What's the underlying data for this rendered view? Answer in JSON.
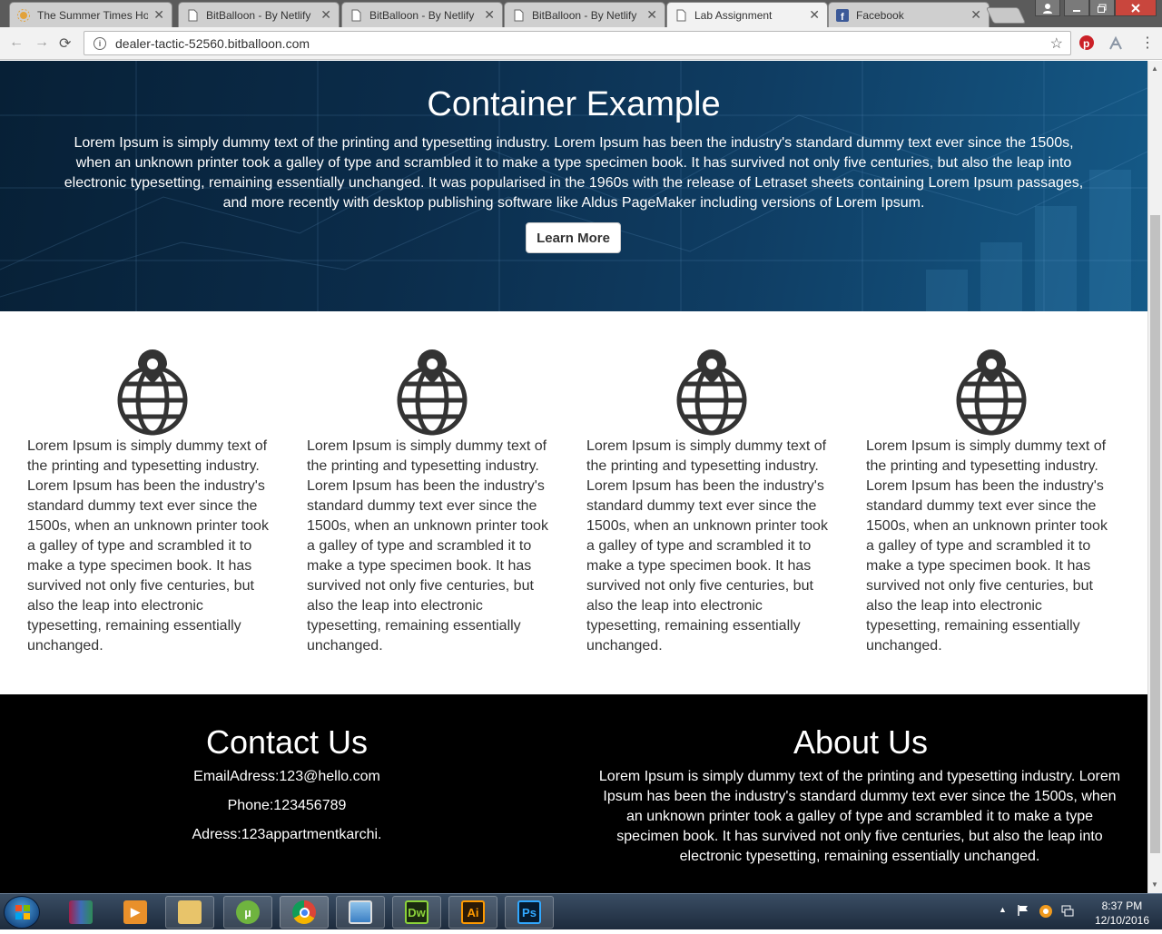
{
  "browser": {
    "tabs": [
      {
        "label": "The Summer Times Ho",
        "icon": "sun-icon"
      },
      {
        "label": "BitBalloon - By Netlify",
        "icon": "page-icon"
      },
      {
        "label": "BitBalloon - By Netlify",
        "icon": "page-icon"
      },
      {
        "label": "BitBalloon - By Netlify",
        "icon": "page-icon"
      },
      {
        "label": "Lab Assignment",
        "icon": "page-icon",
        "active": true
      },
      {
        "label": "Facebook",
        "icon": "facebook-icon"
      }
    ],
    "url": "dealer-tactic-52560.bitballoon.com"
  },
  "hero": {
    "title": "Container Example",
    "text": "Lorem Ipsum is simply dummy text of the printing and typesetting industry. Lorem Ipsum has been the industry's standard dummy text ever since the 1500s, when an unknown printer took a galley of type and scrambled it to make a type specimen book. It has survived not only five centuries, but also the leap into electronic typesetting, remaining essentially unchanged. It was popularised in the 1960s with the release of Letraset sheets containing Lorem Ipsum passages, and more recently with desktop publishing software like Aldus PageMaker including versions of Lorem Ipsum.",
    "button": "Learn More"
  },
  "features": [
    {
      "icon": "globe-pin-icon",
      "text": "Lorem Ipsum is simply dummy text of the printing and typesetting industry. Lorem Ipsum has been the industry's standard dummy text ever since the 1500s, when an unknown printer took a galley of type and scrambled it to make a type specimen book. It has survived not only five centuries, but also the leap into electronic typesetting, remaining essentially unchanged."
    },
    {
      "icon": "globe-pin-icon",
      "text": "Lorem Ipsum is simply dummy text of the printing and typesetting industry. Lorem Ipsum has been the industry's standard dummy text ever since the 1500s, when an unknown printer took a galley of type and scrambled it to make a type specimen book. It has survived not only five centuries, but also the leap into electronic typesetting, remaining essentially unchanged."
    },
    {
      "icon": "globe-pin-icon",
      "text": "Lorem Ipsum is simply dummy text of the printing and typesetting industry. Lorem Ipsum has been the industry's standard dummy text ever since the 1500s, when an unknown printer took a galley of type and scrambled it to make a type specimen book. It has survived not only five centuries, but also the leap into electronic typesetting, remaining essentially unchanged."
    },
    {
      "icon": "globe-pin-icon",
      "text": "Lorem Ipsum is simply dummy text of the printing and typesetting industry. Lorem Ipsum has been the industry's standard dummy text ever since the 1500s, when an unknown printer took a galley of type and scrambled it to make a type specimen book. It has survived not only five centuries, but also the leap into electronic typesetting, remaining essentially unchanged."
    }
  ],
  "footer": {
    "contact": {
      "title": "Contact Us",
      "email": "EmailAdress:123@hello.com",
      "phone": "Phone:123456789",
      "address": "Adress:123appartmentkarchi."
    },
    "about": {
      "title": "About Us",
      "text": "Lorem Ipsum is simply dummy text of the printing and typesetting industry. Lorem Ipsum has been the industry's standard dummy text ever since the 1500s, when an unknown printer took a galley of type and scrambled it to make a type specimen book. It has survived not only five centuries, but also the leap into electronic typesetting, remaining essentially unchanged."
    }
  },
  "taskbar": {
    "apps": [
      {
        "name": "winrar",
        "icon": "winrar-icon"
      },
      {
        "name": "media-player",
        "icon": "media-player-icon"
      },
      {
        "name": "file-explorer",
        "icon": "folder-icon"
      },
      {
        "name": "utorrent",
        "icon": "utorrent-icon",
        "glyph": "µ"
      },
      {
        "name": "chrome",
        "icon": "chrome-icon",
        "active": true
      },
      {
        "name": "photo-viewer",
        "icon": "photo-viewer-icon"
      },
      {
        "name": "dreamweaver",
        "icon": "dreamweaver-icon",
        "glyph": "Dw"
      },
      {
        "name": "illustrator",
        "icon": "illustrator-icon",
        "glyph": "Ai"
      },
      {
        "name": "photoshop",
        "icon": "photoshop-icon",
        "glyph": "Ps"
      }
    ],
    "time": "8:37 PM",
    "date": "12/10/2016"
  },
  "colors": {
    "hero_dark": "#072036",
    "hero_light": "#155a88",
    "footer_bg": "#000000",
    "body_text": "#333333"
  }
}
